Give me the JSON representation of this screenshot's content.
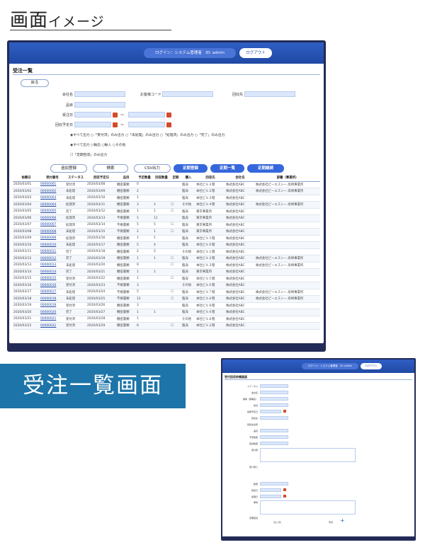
{
  "heading": {
    "main": "画面",
    "sub": "イメージ"
  },
  "caption": "受注一覧画面",
  "app": {
    "login_info": "ログイン：システム管理者　ID: admin",
    "logout": "ログアウト",
    "screen_title": "受注一覧",
    "search_btn": "戻る",
    "filters": {
      "company": "会社名",
      "shop_code": "お客様コード",
      "collection": "回収先",
      "product": "品目",
      "received_date": "受注日",
      "collect_date": "回収予定日"
    },
    "tilde": "〜",
    "radio_line1": "◉すべて出力 ○「受付済」のみ出力 ○「未処理」のみ出力 ○「処理済」のみ出力 ○「完了」のみ出力",
    "radio_line2": "◉すべて出力 ○輸出 ○輸入 ○その他",
    "check_line": "☐「定期回収」のみ出力",
    "buttons": {
      "add": "追加登録",
      "search": "検索",
      "csv": "CSV出力",
      "periodic_reg": "定期登録",
      "periodic_list": "定期一覧",
      "periodic_continue": "定期継続"
    },
    "columns": [
      "依頼日",
      "受付番号",
      "ステータス",
      "回収予定日",
      "品目",
      "予定数量",
      "回収数量",
      "定期",
      "購入",
      "回収先",
      "会社名",
      "部署（事業所）"
    ],
    "rows": [
      [
        "2020/03/01",
        "00000001",
        "受付済",
        "2020/03/08",
        "機密書類",
        "0",
        "",
        "",
        "臨海",
        "本社ビル２階",
        "株式会社ABC",
        "株式会社ピーエスシー 高崎事業所"
      ],
      [
        "2020/03/02",
        "00000002",
        "未処理",
        "2020/03/09",
        "機密書類",
        "2",
        "",
        "",
        "臨海",
        "本社ビル２階",
        "株式会社ABC",
        "株式会社ピーエスシー 高崎事業所"
      ],
      [
        "2020/03/03",
        "00000003",
        "未処理",
        "2020/03/10",
        "機密書類",
        "1",
        "",
        "",
        "臨海",
        "本社ビル３階",
        "株式会社ABC",
        ""
      ],
      [
        "2020/03/04",
        "00000004",
        "処理済",
        "2020/03/11",
        "機密書類",
        "3",
        "2",
        "☐",
        "その他",
        "本社ビル４階",
        "株式会社ABC",
        "株式会社ピーエスシー 高崎事業所"
      ],
      [
        "2020/03/05",
        "00000005",
        "完了",
        "2020/03/12",
        "機密書類",
        "1",
        "1",
        "☐",
        "臨海",
        "東京事業所",
        "株式会社ABC",
        ""
      ],
      [
        "2020/03/06",
        "00000006",
        "処理済",
        "2020/03/13",
        "不要書類",
        "1",
        "11",
        "",
        "臨海",
        "東京事業所",
        "株式会社ABC",
        ""
      ],
      [
        "2020/03/07",
        "00000007",
        "処理済",
        "2020/03/14",
        "不要書類",
        "5",
        "5",
        "☐",
        "臨海",
        "東京事業所",
        "株式会社ABC",
        ""
      ],
      [
        "2020/03/08",
        "00000008",
        "未処理",
        "2020/03/15",
        "不要書類",
        "2",
        "1",
        "☐",
        "臨海",
        "東京事業所",
        "株式会社ABC",
        ""
      ],
      [
        "2020/03/09",
        "00000009",
        "処理済",
        "2020/03/16",
        "機密書類",
        "1",
        "1",
        "",
        "臨海",
        "本社ビル５階",
        "株式会社ABC",
        ""
      ],
      [
        "2020/03/10",
        "00000010",
        "未処理",
        "2020/03/17",
        "機密書類",
        "5",
        "4",
        "",
        "臨海",
        "本社ビル６階",
        "株式会社ABC",
        ""
      ],
      [
        "2020/03/11",
        "00000011",
        "完了",
        "2020/03/18",
        "機密書類",
        "2",
        "2",
        "",
        "その他",
        "本社ビル１階",
        "株式会社ABC",
        ""
      ],
      [
        "2020/03/12",
        "00000012",
        "完了",
        "2020/03/19",
        "機密書類",
        "1",
        "1",
        "☐",
        "臨海",
        "本社ビル２階",
        "株式会社ABC",
        "株式会社ピーエスシー 高崎事業所"
      ],
      [
        "2020/03/13",
        "00000013",
        "未処理",
        "2020/03/20",
        "機密書類",
        "9",
        "",
        "☐",
        "臨海",
        "本社ビル３階",
        "株式会社ABC",
        "株式会社ピーエスシー 高崎事業所"
      ],
      [
        "2020/03/14",
        "00000014",
        "完了",
        "2020/03/21",
        "機密書類",
        "1",
        "1",
        "",
        "臨海",
        "東京事業所",
        "株式会社ABC",
        ""
      ],
      [
        "2020/03/15",
        "00000015",
        "受付済",
        "2020/03/22",
        "機密書類",
        "1",
        "",
        "☐",
        "臨海",
        "本社ビル５階",
        "株式会社ABC",
        ""
      ],
      [
        "2020/03/16",
        "00000016",
        "受付済",
        "2020/03/23",
        "不要書類",
        "3",
        "",
        "",
        "その他",
        "本社ビル６階",
        "株式会社ABC",
        ""
      ],
      [
        "2020/03/17",
        "00000017",
        "未処理",
        "2020/03/24",
        "不要書類",
        "5",
        "",
        "☐",
        "臨海",
        "本社ビル７階",
        "株式会社ABC",
        "株式会社ピーエスシー 高崎事業所"
      ],
      [
        "2020/03/18",
        "00000018",
        "未処理",
        "2020/03/25",
        "不要書類",
        "12",
        "",
        "☐",
        "臨海",
        "本社ビル８階",
        "株式会社ABC",
        "株式会社ピーエスシー 高崎事業所"
      ],
      [
        "2020/03/19",
        "00000019",
        "受付済",
        "2020/03/26",
        "機密書類",
        "3",
        "",
        "",
        "臨海",
        "本社ビル９階",
        "株式会社ABC",
        ""
      ],
      [
        "2020/03/20",
        "00000020",
        "完了",
        "2020/03/27",
        "機密書類",
        "1",
        "1",
        "",
        "臨海",
        "本社ビル６階",
        "株式会社ABC",
        ""
      ],
      [
        "2020/03/21",
        "00000021",
        "受付済",
        "2020/03/28",
        "機密書類",
        "1",
        "",
        "",
        "その他",
        "本社ビル８階",
        "株式会社ABC",
        ""
      ],
      [
        "2020/03/22",
        "00000022",
        "受付済",
        "2020/03/29",
        "機密書類",
        "8",
        "",
        "☐",
        "臨海",
        "本社ビル２階",
        "株式会社ABC",
        ""
      ]
    ]
  },
  "thumb": {
    "login_info": "ログイン：システム管理者　ID: admin",
    "logout": "ログアウト",
    "title": "受付回収依頼画面",
    "fields": [
      "ステータス",
      "会社名",
      "顧客（部署名）",
      "担当",
      "依頼予定日",
      "回収先",
      "回収先住所",
      "品目",
      "予定数量",
      "回収数量",
      "受付者",
      "受け取り",
      "数量",
      "回収日",
      "処理日",
      "備考",
      "定期回収"
    ],
    "note": "（記入例）",
    "save": "登録"
  }
}
